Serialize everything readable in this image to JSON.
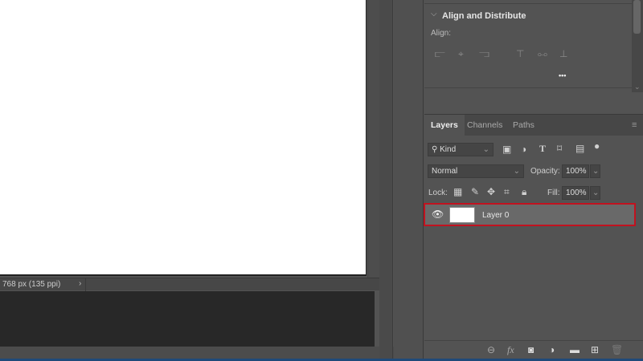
{
  "status_bar": {
    "doc_info": "768 px (135 ppi)",
    "arrow": "›"
  },
  "align_panel": {
    "title": "Align and Distribute",
    "align_label": "Align:",
    "more": "•••"
  },
  "layers_panel": {
    "tabs": [
      "Layers",
      "Channels",
      "Paths"
    ],
    "filter": {
      "value": "Kind"
    },
    "blend_mode": "Normal",
    "opacity_label": "Opacity:",
    "opacity": "100%",
    "lock_label": "Lock:",
    "fill_label": "Fill:",
    "fill": "100%",
    "layers": [
      {
        "name": "Layer 0",
        "visible": true,
        "selected": true
      }
    ]
  },
  "colors": {
    "highlight": "#c1121f",
    "panel": "#535353"
  }
}
